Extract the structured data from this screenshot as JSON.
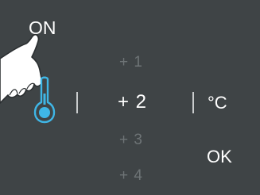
{
  "power": {
    "label": "ON"
  },
  "temperature": {
    "options": [
      "+ 1",
      "+ 2",
      "+ 3",
      "+ 4"
    ],
    "selected": "+ 2",
    "unit": "°C"
  },
  "confirm": {
    "label": "OK"
  },
  "colors": {
    "panel_bg": "#3f4446",
    "text_active": "#ffffff",
    "text_inactive": "#6e7476",
    "accent": "#3fb6e6"
  },
  "icons": [
    "thermometer-icon",
    "pointing-hand-icon"
  ]
}
